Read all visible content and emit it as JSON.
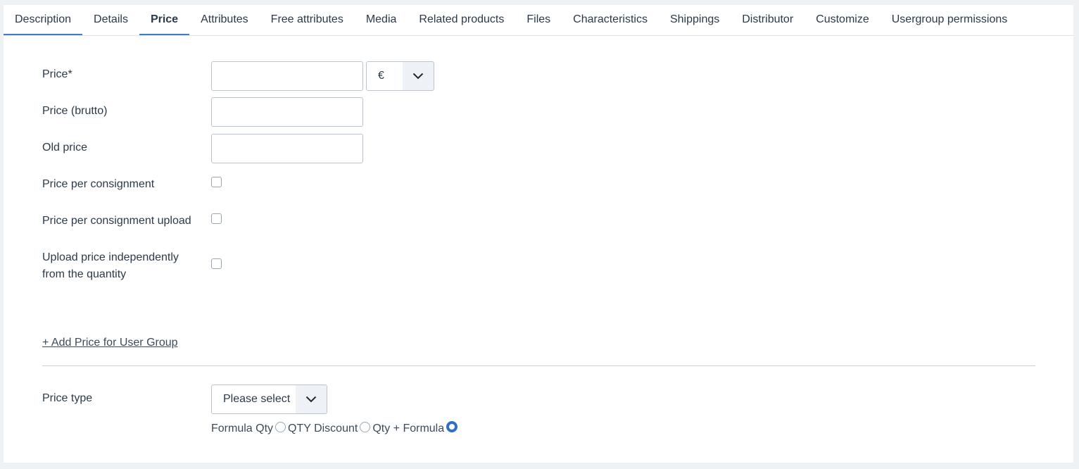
{
  "tabs": [
    {
      "label": "Description"
    },
    {
      "label": "Details"
    },
    {
      "label": "Price"
    },
    {
      "label": "Attributes"
    },
    {
      "label": "Free attributes"
    },
    {
      "label": "Media"
    },
    {
      "label": "Related products"
    },
    {
      "label": "Files"
    },
    {
      "label": "Characteristics"
    },
    {
      "label": "Shippings"
    },
    {
      "label": "Distributor"
    },
    {
      "label": "Customize"
    },
    {
      "label": "Usergroup permissions"
    }
  ],
  "form": {
    "price_label": "Price*",
    "price_value": "",
    "currency_value": "€",
    "price_brutto_label": "Price (brutto)",
    "price_brutto_value": "",
    "old_price_label": "Old price",
    "old_price_value": "",
    "per_consignment_label": "Price per consignment",
    "per_consignment_upload_label": "Price per consignment upload",
    "upload_independent_line1": "Upload price independently",
    "upload_independent_line2": "from the quantity",
    "add_price_link": "+ Add Price for User Group",
    "price_type_label": "Price type",
    "price_type_value": "Please select",
    "radio_options": [
      {
        "label": "Formula Qty",
        "checked": false
      },
      {
        "label": "QTY Discount",
        "checked": false
      },
      {
        "label": "Qty + Formula",
        "checked": true
      }
    ]
  },
  "colors": {
    "accent": "#3f7ec6",
    "radio_checked": "#2f6fc4",
    "background": "#eef2f5"
  }
}
